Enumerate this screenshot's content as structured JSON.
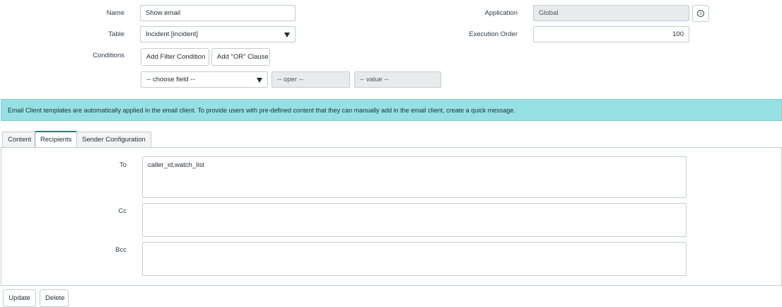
{
  "form": {
    "name_label": "Name",
    "name_value": "Show email",
    "table_label": "Table",
    "table_value": "Incident [incident]",
    "conditions_label": "Conditions",
    "add_filter_label": "Add Filter Condition",
    "add_or_label": "Add \"OR\" Clause",
    "choose_field_value": "-- choose field --",
    "oper_value": "-- oper --",
    "value_value": "-- value --",
    "application_label": "Application",
    "application_value": "Global",
    "execution_order_label": "Execution Order",
    "execution_order_value": "100"
  },
  "banner": {
    "text": "Email Client templates are automatically applied in the email client. To provide users with pre-defined content that they can manually add in the email client, create a quick message."
  },
  "tabs": [
    {
      "label": "Content",
      "active": false
    },
    {
      "label": "Recipients",
      "active": true
    },
    {
      "label": "Sender Configuration",
      "active": false
    }
  ],
  "recipients": {
    "to_label": "To",
    "to_value": "caller_id,watch_list",
    "cc_label": "Cc",
    "cc_value": "",
    "bcc_label": "Bcc",
    "bcc_value": ""
  },
  "actions": {
    "update_label": "Update",
    "delete_label": "Delete"
  },
  "icons": {
    "info": "info-circle-icon",
    "dropdown": "caret-down-icon"
  },
  "colors": {
    "banner_bg": "#96e0e3",
    "active_tab_accent": "#2b7a7e",
    "readonly_bg": "#e8ebec"
  }
}
